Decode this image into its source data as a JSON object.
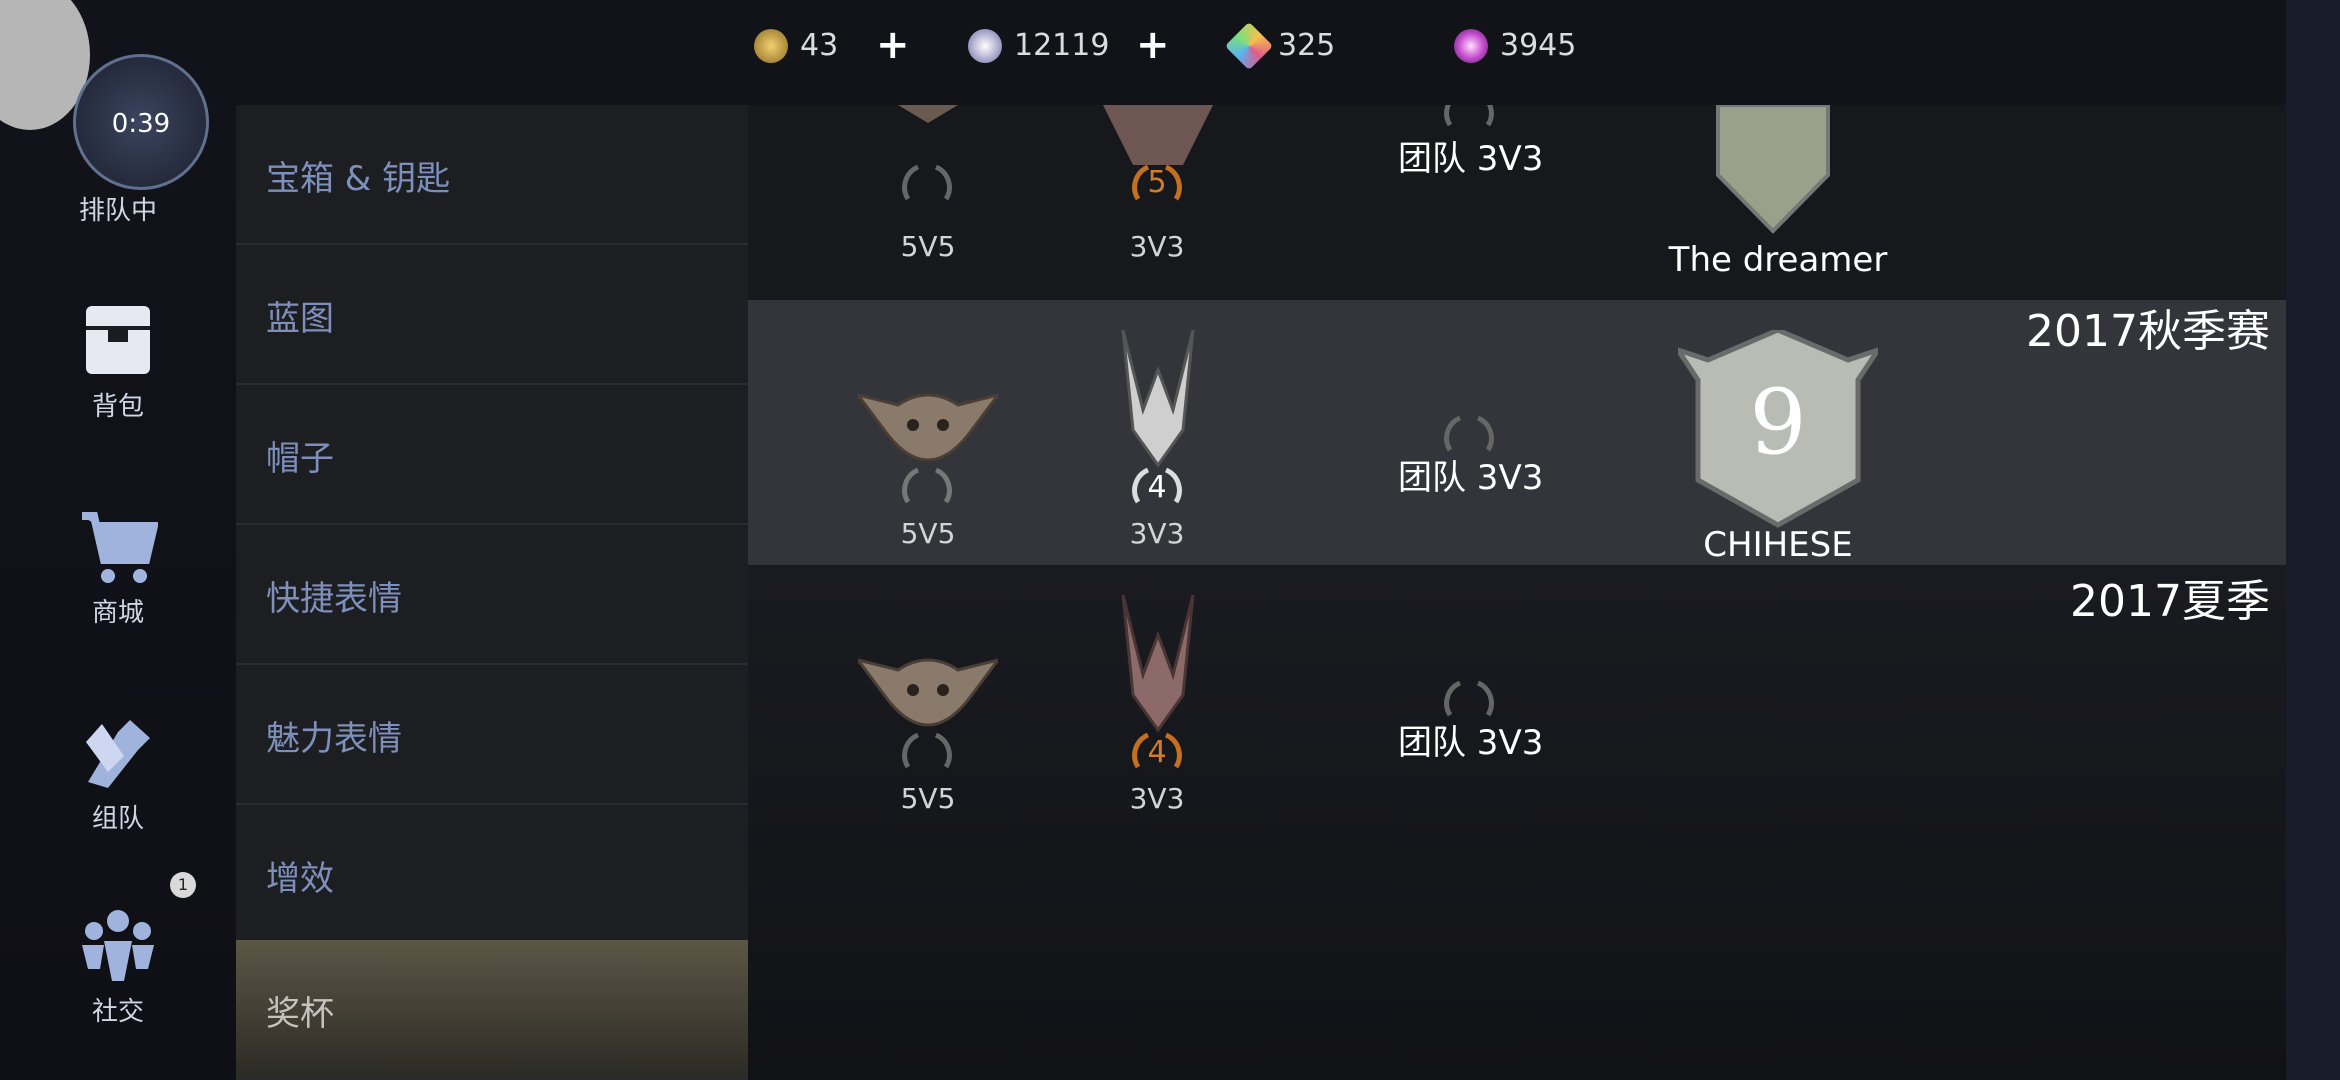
{
  "topbar": {
    "currencies": [
      {
        "name": "gold-coin",
        "value": "43",
        "color": "#c9a04a",
        "has_plus": true
      },
      {
        "name": "silver-token",
        "value": "12119",
        "color": "#b7b3d8",
        "has_plus": true
      },
      {
        "name": "gem",
        "value": "325",
        "color": "#e27aa4",
        "has_plus": false
      },
      {
        "name": "nebula-shard",
        "value": "3945",
        "color": "#d05ad6",
        "has_plus": false
      }
    ],
    "plus": "+"
  },
  "leftnav": {
    "queue_time": "0:39",
    "queue_label": "排队中",
    "items": [
      {
        "label": "背包",
        "icon": "backpack-icon"
      },
      {
        "label": "商城",
        "icon": "cart-icon"
      },
      {
        "label": "组队",
        "icon": "handshake-icon"
      },
      {
        "label": "社交",
        "icon": "people-icon",
        "badge": "1"
      }
    ]
  },
  "categories": [
    {
      "label": "宝箱 & 钥匙"
    },
    {
      "label": "蓝图"
    },
    {
      "label": "帽子"
    },
    {
      "label": "快捷表情"
    },
    {
      "label": "魅力表情"
    },
    {
      "label": "增效"
    },
    {
      "label": "奖杯",
      "active": true
    }
  ],
  "seasons": [
    {
      "title": "",
      "slots": {
        "a_label": "5V5",
        "b_label": "3V3",
        "b_number": "5",
        "team": "团队 3V3",
        "banner_name": "The dreamer"
      }
    },
    {
      "title": "2017秋季赛",
      "slots": {
        "a_label": "5V5",
        "b_label": "3V3",
        "b_number": "4",
        "team": "团队 3V3",
        "banner_number": "9",
        "banner_name": "CHIHESE"
      }
    },
    {
      "title": "2017夏季",
      "slots": {
        "a_label": "5V5",
        "b_label": "3V3",
        "b_number": "4",
        "team": "团队 3V3"
      }
    }
  ]
}
